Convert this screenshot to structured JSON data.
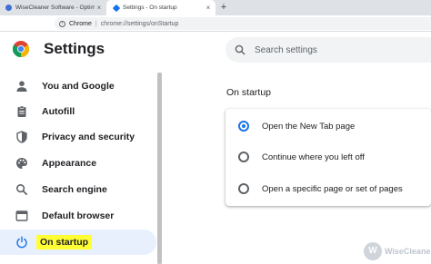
{
  "browser": {
    "tabs": [
      {
        "title": "WiseCleaner Software - Optimiz",
        "active": false
      },
      {
        "title": "Settings - On startup",
        "active": true
      }
    ],
    "new_tab_label": "+",
    "close_label": "×",
    "omnibox": {
      "origin": "Chrome",
      "separator": "|",
      "url": "chrome://settings/onStartup"
    }
  },
  "header": {
    "title": "Settings",
    "search_placeholder": "Search settings"
  },
  "sidebar": {
    "items": [
      {
        "label": "You and Google",
        "icon": "person-icon"
      },
      {
        "label": "Autofill",
        "icon": "clipboard-icon"
      },
      {
        "label": "Privacy and security",
        "icon": "shield-icon"
      },
      {
        "label": "Appearance",
        "icon": "palette-icon"
      },
      {
        "label": "Search engine",
        "icon": "search-icon"
      },
      {
        "label": "Default browser",
        "icon": "browser-icon"
      },
      {
        "label": "On startup",
        "icon": "power-icon",
        "active": true
      }
    ]
  },
  "main": {
    "section_title": "On startup",
    "options": [
      {
        "label": "Open the New Tab page",
        "checked": true
      },
      {
        "label": "Continue where you left off",
        "checked": false
      },
      {
        "label": "Open a specific page or set of pages",
        "checked": false
      }
    ]
  },
  "watermark": {
    "text": "WiseCleaner"
  },
  "colors": {
    "accent": "#1a73e8",
    "active_nav_bg": "#e8f0fe",
    "highlight": "#ffff33"
  }
}
